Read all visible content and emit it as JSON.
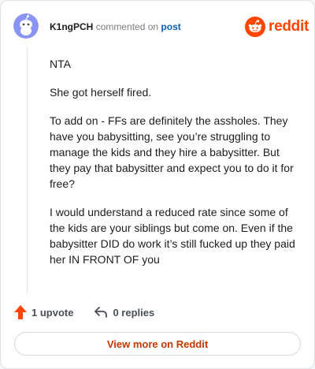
{
  "header": {
    "username": "K1ngPCH",
    "action_text": "commented on",
    "post_link": "post",
    "brand": "reddit"
  },
  "comment": {
    "paragraphs": [
      "NTA",
      "She got herself fired.",
      "To add on - FFs are definitely the assholes. They have you babysitting, see you’re struggling to manage the kids and they hire a babysitter. But they pay that babysitter and expect you to do it for free?",
      "I would understand a reduced rate since some of the kids are your siblings but come on. Even if the babysitter DID do work it’s still fucked up they paid her IN FRONT OF you"
    ]
  },
  "actions": {
    "upvote_label": "1 upvote",
    "replies_label": "0 replies"
  },
  "footer": {
    "view_more_label": "View more on Reddit"
  },
  "colors": {
    "brand": "#ff4500",
    "link": "#0b5fb0",
    "avatar": "#8a93f6",
    "view_more_text": "#c83500"
  }
}
